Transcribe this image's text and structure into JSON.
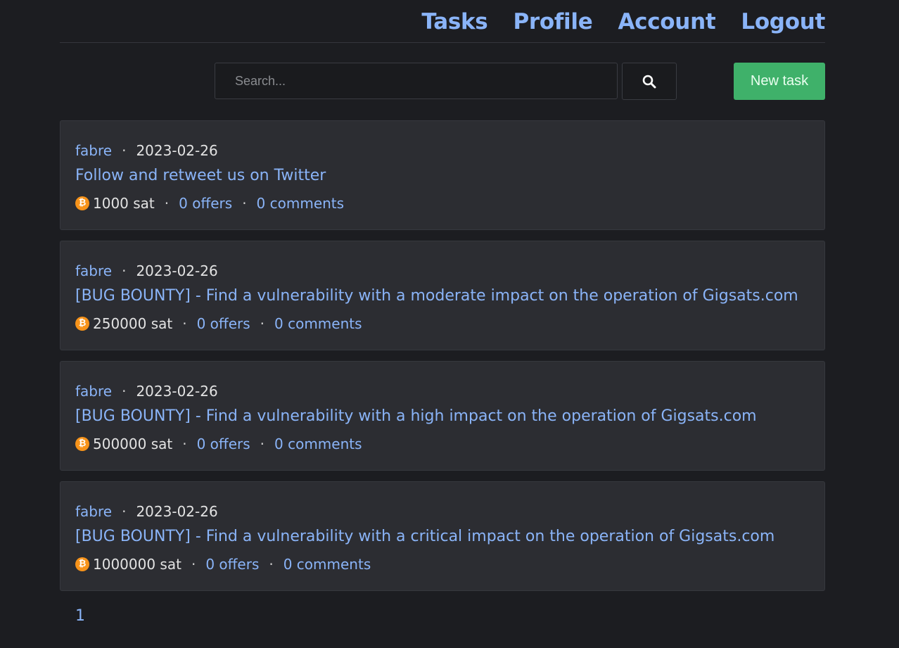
{
  "nav": {
    "items": [
      "Tasks",
      "Profile",
      "Account",
      "Logout"
    ]
  },
  "search": {
    "placeholder": "Search..."
  },
  "toolbar": {
    "new_task_label": "New task"
  },
  "separator": "·",
  "tasks": [
    {
      "author": "fabre",
      "date": "2023-02-26",
      "title": "Follow and retweet us on Twitter",
      "reward": "1000 sat",
      "offers": "0 offers",
      "comments": "0 comments"
    },
    {
      "author": "fabre",
      "date": "2023-02-26",
      "title": "[BUG BOUNTY] - Find a vulnerability with a moderate impact on the operation of Gigsats.com",
      "reward": "250000 sat",
      "offers": "0 offers",
      "comments": "0 comments"
    },
    {
      "author": "fabre",
      "date": "2023-02-26",
      "title": "[BUG BOUNTY] - Find a vulnerability with a high impact on the operation of Gigsats.com",
      "reward": "500000 sat",
      "offers": "0 offers",
      "comments": "0 comments"
    },
    {
      "author": "fabre",
      "date": "2023-02-26",
      "title": "[BUG BOUNTY] - Find a vulnerability with a critical impact on the operation of Gigsats.com",
      "reward": "1000000 sat",
      "offers": "0 offers",
      "comments": "0 comments"
    }
  ],
  "pagination": {
    "current_page": "1"
  },
  "icons": {
    "search": "search-icon",
    "bitcoin": "bitcoin-icon",
    "bitcoin_glyph": "₿"
  },
  "colors": {
    "background": "#1c1d21",
    "card": "#2c2d32",
    "link": "#8ab4f8",
    "primary_button": "#3fb16a",
    "bitcoin": "#f7931a"
  }
}
